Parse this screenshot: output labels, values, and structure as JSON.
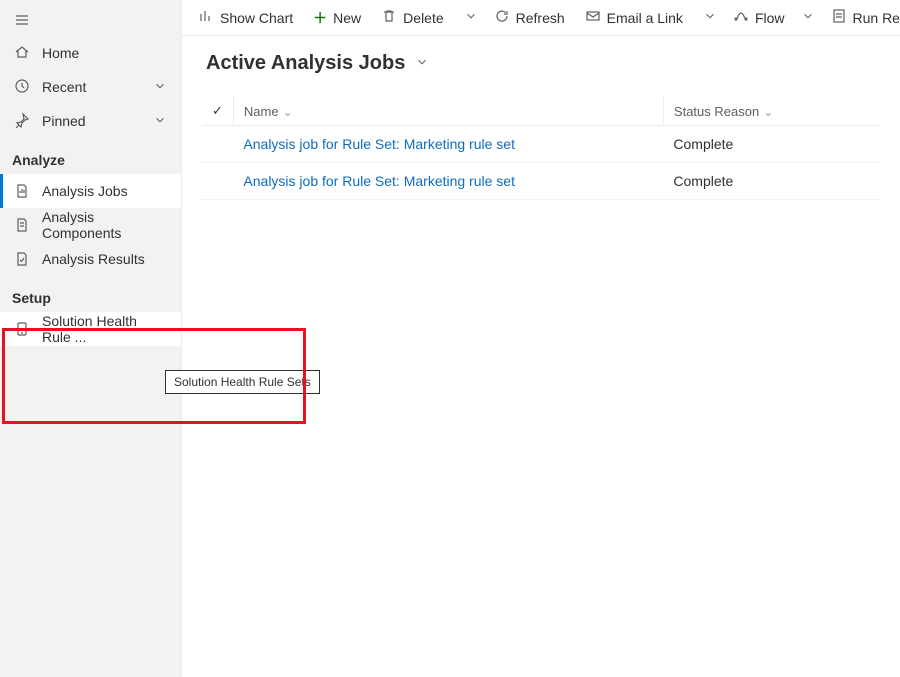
{
  "sidebar": {
    "top": [
      {
        "label": "Home"
      },
      {
        "label": "Recent"
      },
      {
        "label": "Pinned"
      }
    ],
    "sections": [
      {
        "label": "Analyze",
        "items": [
          {
            "label": "Analysis Jobs"
          },
          {
            "label": "Analysis Components"
          },
          {
            "label": "Analysis Results"
          }
        ]
      },
      {
        "label": "Setup",
        "items": [
          {
            "label": "Solution Health Rule ..."
          }
        ]
      }
    ]
  },
  "tooltip": "Solution Health Rule Sets",
  "commands": {
    "show_chart": "Show Chart",
    "new": "New",
    "delete": "Delete",
    "refresh": "Refresh",
    "email_link": "Email a Link",
    "flow": "Flow",
    "run_report": "Run Report"
  },
  "view": {
    "title": "Active Analysis Jobs",
    "columns": {
      "name": "Name",
      "status_reason": "Status Reason"
    },
    "rows": [
      {
        "name": "Analysis job for Rule Set: Marketing rule set",
        "status": "Complete"
      },
      {
        "name": "Analysis job for Rule Set: Marketing rule set",
        "status": "Complete"
      }
    ]
  }
}
